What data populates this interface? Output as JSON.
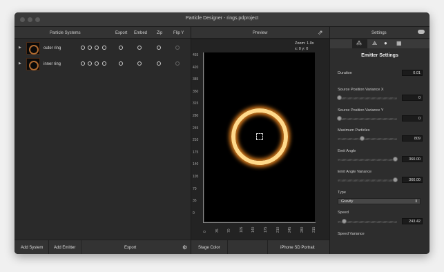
{
  "window": {
    "title": "Particle Designer - rings.pdproject"
  },
  "left": {
    "header": {
      "col_systems": "Particle Systems",
      "col_export": "Export",
      "col_embed": "Embed",
      "col_zip": "Zip",
      "col_flip": "Flip Y"
    },
    "rows": [
      {
        "name": "outer ring"
      },
      {
        "name": "inner ring"
      }
    ],
    "bottom": {
      "add_system": "Add System",
      "add_emitter": "Add Emitter",
      "export": "Export"
    }
  },
  "preview": {
    "header": "Preview",
    "zoom": "Zoom: 1.0x",
    "coords": "x: 0 y: 0",
    "y_ticks": [
      "455",
      "420",
      "385",
      "350",
      "315",
      "280",
      "245",
      "210",
      "175",
      "140",
      "105",
      "70",
      "35",
      "0"
    ],
    "x_ticks": [
      "0",
      "35",
      "70",
      "105",
      "140",
      "175",
      "210",
      "245",
      "280",
      "315"
    ],
    "bottom": {
      "stage_color": "Stage Color",
      "device": "iPhone SD Portrait"
    }
  },
  "settings": {
    "header": "Settings",
    "section_title": "Emitter Settings",
    "fields": {
      "duration": {
        "label": "Duration",
        "value": "0.01"
      },
      "pos_var_x": {
        "label": "Source Position Variance X",
        "value": "0"
      },
      "pos_var_y": {
        "label": "Source Position Variance Y",
        "value": "0"
      },
      "max_particles": {
        "label": "Maximum Particles",
        "value": "809"
      },
      "emit_angle": {
        "label": "Emit Angle",
        "value": "360.00"
      },
      "emit_angle_var": {
        "label": "Emit Angle Variance",
        "value": "360.00"
      },
      "type": {
        "label": "Type",
        "value": "Gravity"
      },
      "speed": {
        "label": "Speed",
        "value": "243.42"
      },
      "speed_var": {
        "label": "Speed Variance"
      }
    }
  }
}
